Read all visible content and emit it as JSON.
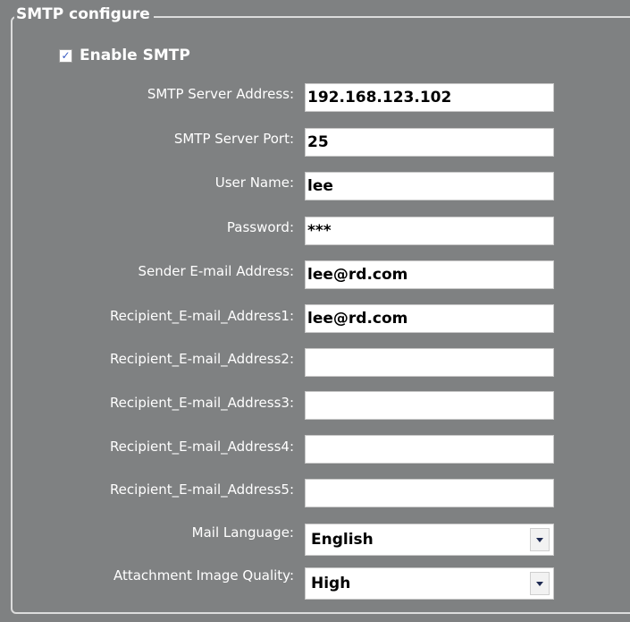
{
  "group": {
    "title": "SMTP configure"
  },
  "enable_smtp": {
    "label": "Enable SMTP",
    "checked": true,
    "check_mark": "☑"
  },
  "fields": [
    {
      "label": "SMTP Server Address:",
      "value": "192.168.123.102"
    },
    {
      "label": "SMTP Server Port:",
      "value": "25"
    },
    {
      "label": "User Name:",
      "value": "lee"
    },
    {
      "label": "Password:",
      "value": "***"
    },
    {
      "label": "Sender E-mail Address:",
      "value": "lee@rd.com"
    },
    {
      "label": "Recipient_E-mail_Address1:",
      "value": "lee@rd.com"
    },
    {
      "label": "Recipient_E-mail_Address2:",
      "value": ""
    },
    {
      "label": "Recipient_E-mail_Address3:",
      "value": ""
    },
    {
      "label": "Recipient_E-mail_Address4:",
      "value": ""
    },
    {
      "label": "Recipient_E-mail_Address5:",
      "value": ""
    }
  ],
  "mail_language": {
    "label": "Mail Language:",
    "value": "English"
  },
  "attachment_quality": {
    "label": "Attachment Image Quality:",
    "value": "High"
  },
  "colors": {
    "panel": "#7f8182",
    "border": "#dcdcdc",
    "text": "#ffffff"
  },
  "icons": {
    "checkbox": "checkbox-checked-icon",
    "dropdown": "chevron-down-icon"
  }
}
